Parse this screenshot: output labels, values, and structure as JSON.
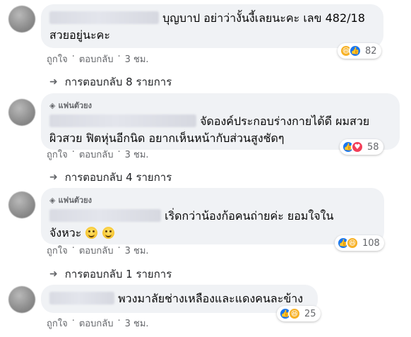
{
  "comments": [
    {
      "fan_label": "",
      "text_line1": "บุญบาป อย่าว่างั้นงี้เลยนะคะ เลข 482/18",
      "text_line2": "สวยอยู่นะคะ",
      "like_label": "ถูกใจ",
      "reply_label": "ตอบกลับ",
      "time": "3 ชม.",
      "reactions": [
        "haha",
        "like"
      ],
      "reaction_count": "82",
      "replies_label": "การตอบกลับ 8 รายการ"
    },
    {
      "fan_label": "แฟนตัวยง",
      "text_line1": "จัดองค์ประกอบร่างกายได้ดี ผมสวย",
      "text_line2": "ผิวสวย ฟิตหุ่นอีกนิด อยากเห็นหน้ากับส่วนสูงชัดๆ",
      "like_label": "ถูกใจ",
      "reply_label": "ตอบกลับ",
      "time": "3 ชม.",
      "reactions": [
        "like",
        "love"
      ],
      "reaction_count": "58",
      "replies_label": "การตอบกลับ 4 รายการ"
    },
    {
      "fan_label": "แฟนตัวยง",
      "text_line1": "เริ่ดกว่าน้องก้อคนถ่ายค่ะ ยอมใจใน",
      "text_line2": "จังหวะ",
      "like_label": "ถูกใจ",
      "reply_label": "ตอบกลับ",
      "time": "3 ชม.",
      "reactions": [
        "like",
        "haha"
      ],
      "reaction_count": "108",
      "replies_label": "การตอบกลับ 1 รายการ"
    },
    {
      "fan_label": "",
      "text_line1": "พวงมาลัยช่างเหลืองและแดงคนละข้าง",
      "text_line2": "",
      "like_label": "ถูกใจ",
      "reply_label": "ตอบกลับ",
      "time": "3 ชม.",
      "reactions": [
        "like",
        "haha"
      ],
      "reaction_count": "25",
      "replies_label": ""
    }
  ],
  "colors": {
    "bubble": "#f0f2f5",
    "secondary_text": "#65676b",
    "like_blue": "#1877f2",
    "love_red": "#f33e58",
    "haha_yellow": "#f7b125"
  }
}
